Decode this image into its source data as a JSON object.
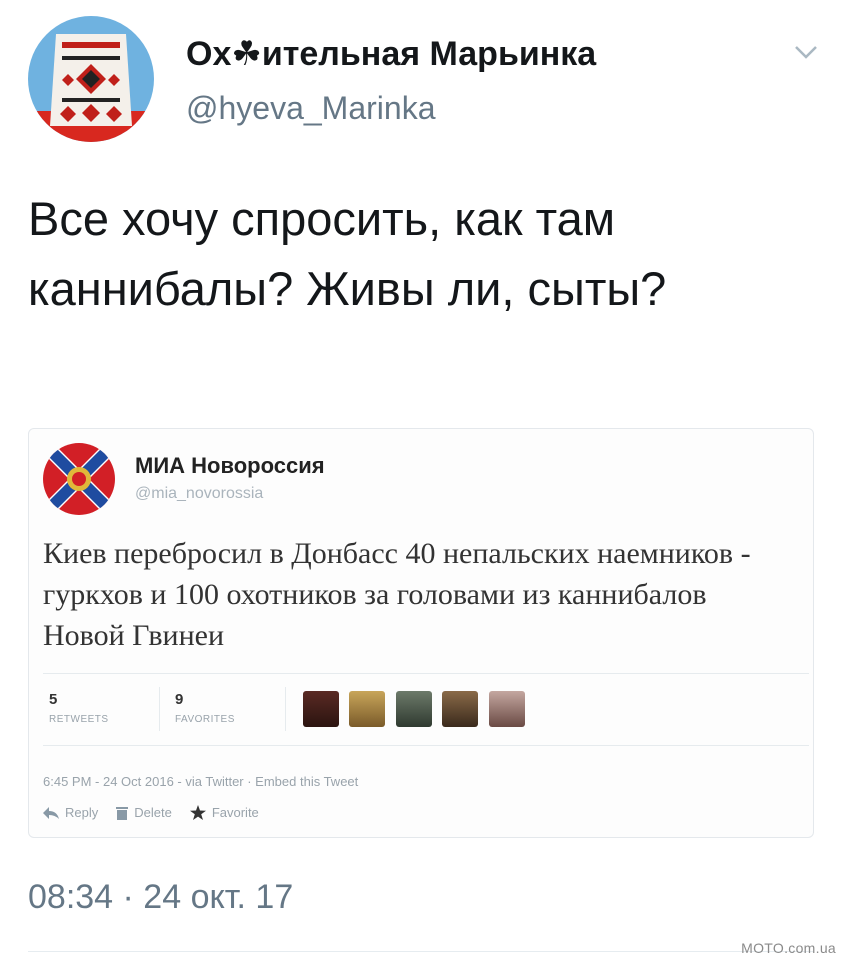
{
  "tweet": {
    "display_name": "Ох☘ительная Марьинка",
    "handle": "@hyeva_Marinka",
    "avatar_icon": "embroidered-shirt-avatar",
    "menu_icon": "chevron-down-icon",
    "text": "Все хочу спросить, как там каннибалы? Живы ли, сыты?",
    "timestamp": "08:34 · 24 окт. 17"
  },
  "embedded_tweet": {
    "display_name": "МИА Новороссия",
    "handle": "@mia_novorossia",
    "avatar_icon": "novorossia-flag-avatar",
    "text": "Киев перебросил в Донбасс 40 непальских наемников - гуркхов и 100 охотников за головами из каннибалов Новой Гвинеи",
    "stats": {
      "retweets_count": "5",
      "retweets_label": "RETWEETS",
      "favorites_count": "9",
      "favorites_label": "FAVORITES"
    },
    "meta": "6:45 PM - 24 Oct 2016 - via Twitter · Embed this Tweet",
    "actions": {
      "reply": "Reply",
      "delete": "Delete",
      "favorite": "Favorite"
    }
  },
  "watermark": "MOTO.com.ua",
  "colors": {
    "text_primary": "#14171a",
    "text_secondary": "#657786",
    "border": "#e6ecf0"
  }
}
